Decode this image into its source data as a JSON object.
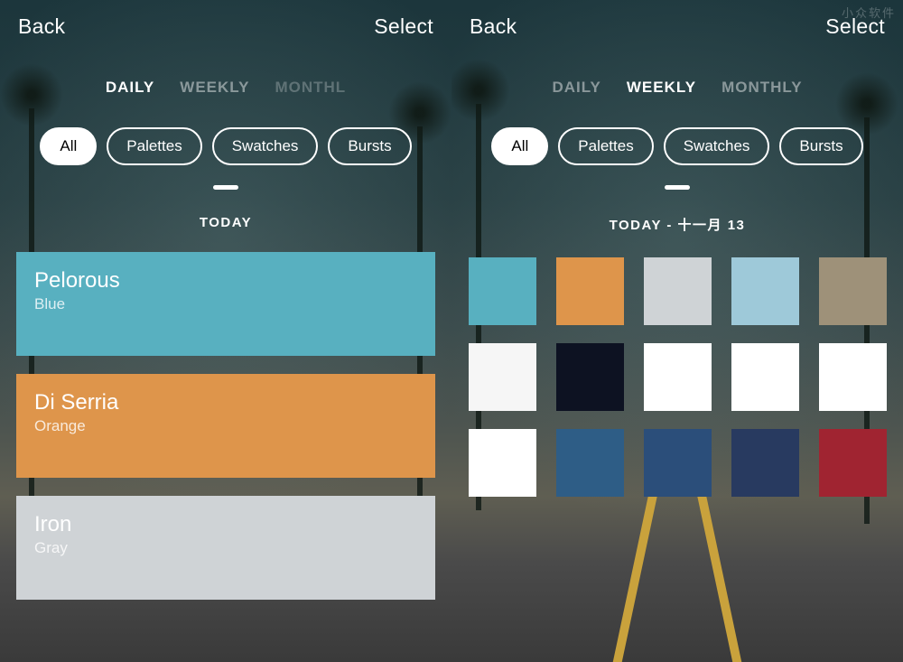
{
  "left": {
    "header": {
      "back": "Back",
      "select": "Select"
    },
    "tabs": {
      "daily": "DAILY",
      "weekly": "WEEKLY",
      "monthly": "MONTHL"
    },
    "filters": {
      "all": "All",
      "palettes": "Palettes",
      "swatches": "Swatches",
      "bursts": "Bursts"
    },
    "section_title": "TODAY",
    "rows": [
      {
        "name": "Pelorous",
        "hue": "Blue",
        "color": "#58b0c0"
      },
      {
        "name": "Di Serria",
        "hue": "Orange",
        "color": "#de954b"
      },
      {
        "name": "Iron",
        "hue": "Gray",
        "color": "#cfd3d6"
      }
    ]
  },
  "right": {
    "header": {
      "back": "Back",
      "select": "Select"
    },
    "tabs": {
      "daily": "DAILY",
      "weekly": "WEEKLY",
      "monthly": "MONTHLY"
    },
    "filters": {
      "all": "All",
      "palettes": "Palettes",
      "swatches": "Swatches",
      "bursts": "Bursts"
    },
    "section_title": "TODAY - 十一月 13",
    "swatches": [
      "#58b0c0",
      "#de954b",
      "#cfd3d6",
      "#9ec9d9",
      "#9e9179",
      "#f6f6f6",
      "#0d1222",
      "#ffffff",
      "#ffffff",
      "#ffffff",
      "#ffffff",
      "#2e5d86",
      "#2b4e7a",
      "#283a60",
      "#a02431"
    ],
    "watermark": "小众软件"
  }
}
